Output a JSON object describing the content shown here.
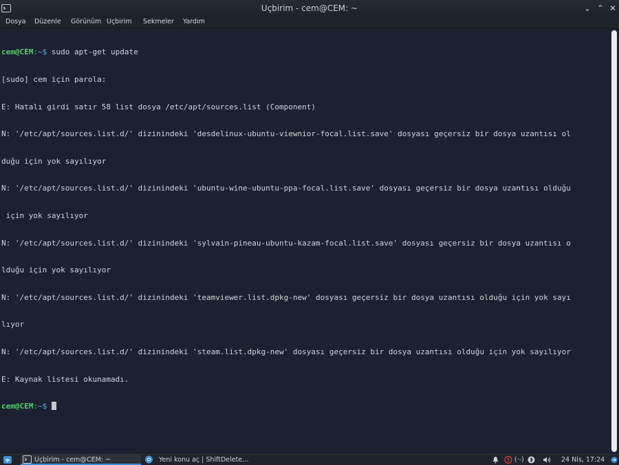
{
  "window": {
    "title": "Uçbirim - cem@CEM: ~",
    "minimize_glyph": "⌄",
    "maximize_glyph": "⌃",
    "close_glyph": "✕"
  },
  "menu": {
    "items": [
      "Dosya",
      "Düzenle",
      "Görünüm",
      "Uçbirim",
      "Sekmeler",
      "Yardım"
    ]
  },
  "terminal": {
    "prompt_user": "cem@CEM",
    "prompt_path": ":~$",
    "command": " sudo apt-get update",
    "output": [
      "[sudo] cem için parola:",
      "E: Hatalı girdi satır 58 list dosya /etc/apt/sources.list (Component)",
      "N: '/etc/apt/sources.list.d/' dizinindeki 'desdelinux-ubuntu-viewnior-focal.list.save' dosyası geçersiz bir dosya uzantısı ol",
      "duğu için yok sayılıyor",
      "N: '/etc/apt/sources.list.d/' dizinindeki 'ubuntu-wine-ubuntu-ppa-focal.list.save' dosyası geçersiz bir dosya uzantısı olduğu",
      " için yok sayılıyor",
      "N: '/etc/apt/sources.list.d/' dizinindeki 'sylvain-pineau-ubuntu-kazam-focal.list.save' dosyası geçersiz bir dosya uzantısı o",
      "lduğu için yok sayılıyor",
      "N: '/etc/apt/sources.list.d/' dizinindeki 'teamviewer.list.dpkg-new' dosyası geçersiz bir dosya uzantısı olduğu için yok sayı",
      "lıyor",
      "N: '/etc/apt/sources.list.d/' dizinindeki 'steam.list.dpkg-new' dosyası geçersiz bir dosya uzantısı olduğu için yok sayılıyor",
      "E: Kaynak listesi okunamadı."
    ]
  },
  "taskbar": {
    "tasks": [
      {
        "label": "Uçbirim - cem@CEM: ~",
        "icon": "terminal-icon",
        "active": true
      },
      {
        "label": "Yeni konu aç | ShiftDelete…",
        "icon": "browser-icon",
        "active": false
      }
    ],
    "clock": "24 Nis, 17:24",
    "network_label": "(·-)"
  },
  "colors": {
    "terminal_bg": "#1b2131",
    "prompt_user": "#52d16b",
    "prompt_path": "#5fa8e8",
    "text": "#d0d4da",
    "accent": "#3f8fd8",
    "alert": "#e0403a"
  }
}
